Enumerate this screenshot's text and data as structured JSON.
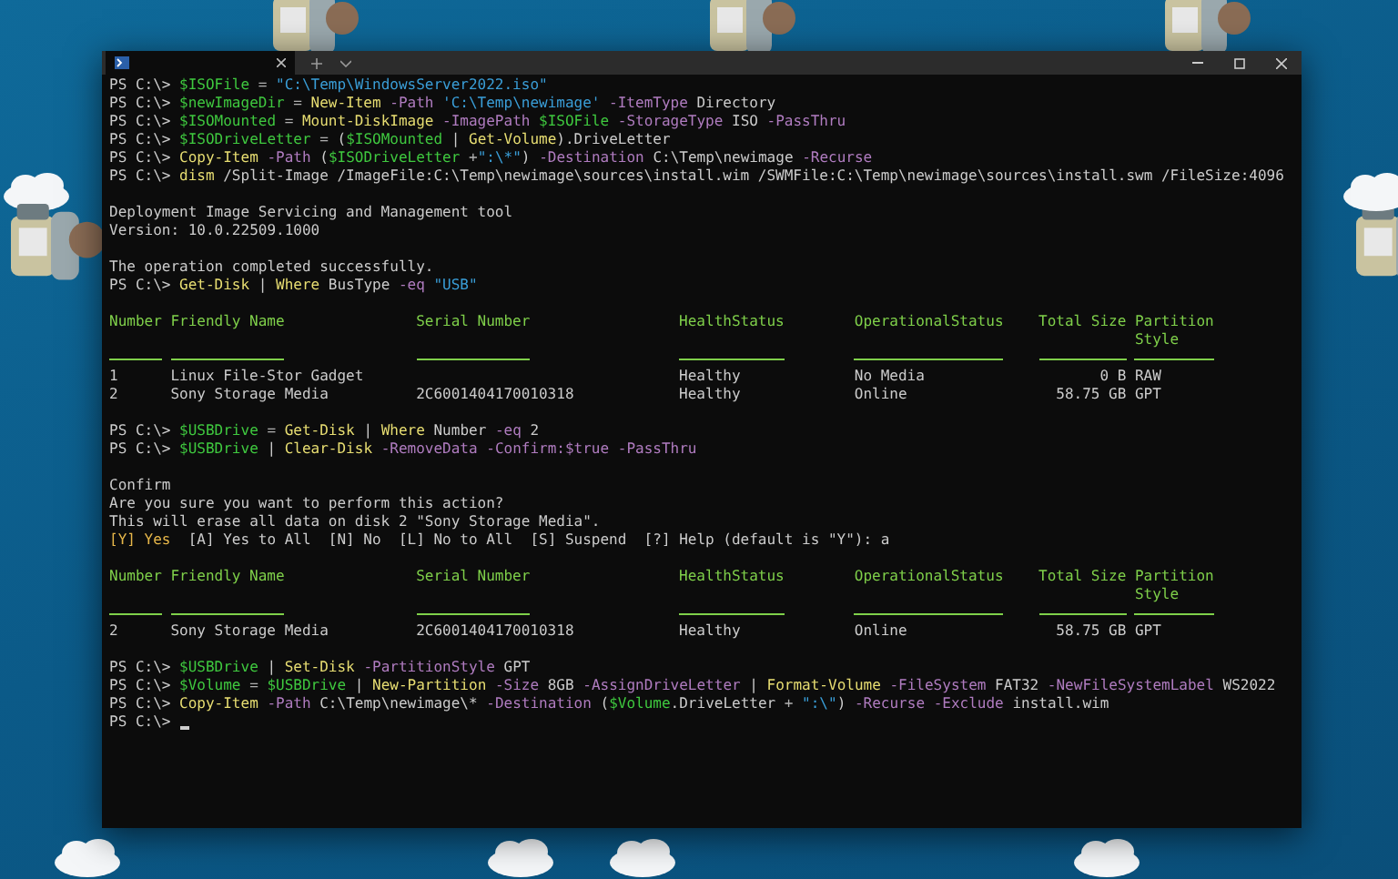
{
  "terminal": {
    "lines": [
      {
        "kind": "command",
        "tokens": [
          {
            "kind": "prompt",
            "text": "PS C:\\> "
          },
          {
            "kind": "variable",
            "text": "$ISOFile"
          },
          {
            "kind": "operator",
            "text": " = "
          },
          {
            "kind": "string",
            "text": "\"C:\\Temp\\WindowsServer2022.iso\""
          }
        ]
      },
      {
        "kind": "command",
        "tokens": [
          {
            "kind": "prompt",
            "text": "PS C:\\> "
          },
          {
            "kind": "variable",
            "text": "$newImageDir"
          },
          {
            "kind": "operator",
            "text": " = "
          },
          {
            "kind": "cmdlet",
            "text": "New-Item"
          },
          {
            "kind": "parameter",
            "text": " -Path"
          },
          {
            "kind": "string",
            "text": " 'C:\\Temp\\newimage'"
          },
          {
            "kind": "parameter",
            "text": " -ItemType"
          },
          {
            "kind": "plain",
            "text": " Directory"
          }
        ]
      },
      {
        "kind": "command",
        "tokens": [
          {
            "kind": "prompt",
            "text": "PS C:\\> "
          },
          {
            "kind": "variable",
            "text": "$ISOMounted"
          },
          {
            "kind": "operator",
            "text": " = "
          },
          {
            "kind": "cmdlet",
            "text": "Mount-DiskImage"
          },
          {
            "kind": "parameter",
            "text": " -ImagePath"
          },
          {
            "kind": "variable",
            "text": " $ISOFile"
          },
          {
            "kind": "parameter",
            "text": " -StorageType"
          },
          {
            "kind": "plain",
            "text": " ISO"
          },
          {
            "kind": "parameter",
            "text": " -PassThru"
          }
        ]
      },
      {
        "kind": "command",
        "tokens": [
          {
            "kind": "prompt",
            "text": "PS C:\\> "
          },
          {
            "kind": "variable",
            "text": "$ISODriveLetter"
          },
          {
            "kind": "operator",
            "text": " = "
          },
          {
            "kind": "plain",
            "text": "("
          },
          {
            "kind": "variable",
            "text": "$ISOMounted"
          },
          {
            "kind": "plain",
            "text": " | "
          },
          {
            "kind": "cmdlet",
            "text": "Get-Volume"
          },
          {
            "kind": "plain",
            "text": ").DriveLetter"
          }
        ]
      },
      {
        "kind": "command",
        "tokens": [
          {
            "kind": "prompt",
            "text": "PS C:\\> "
          },
          {
            "kind": "cmdlet",
            "text": "Copy-Item"
          },
          {
            "kind": "parameter",
            "text": " -Path"
          },
          {
            "kind": "plain",
            "text": " ("
          },
          {
            "kind": "variable",
            "text": "$ISODriveLetter"
          },
          {
            "kind": "operator",
            "text": " +"
          },
          {
            "kind": "string",
            "text": "\":\\*\""
          },
          {
            "kind": "plain",
            "text": ")"
          },
          {
            "kind": "parameter",
            "text": " -Destination"
          },
          {
            "kind": "plain",
            "text": " C:\\Temp\\newimage"
          },
          {
            "kind": "parameter",
            "text": " -Recurse"
          }
        ]
      },
      {
        "kind": "command",
        "tokens": [
          {
            "kind": "prompt",
            "text": "PS C:\\> "
          },
          {
            "kind": "cmdlet",
            "text": "dism"
          },
          {
            "kind": "plain",
            "text": " /Split-Image /ImageFile:C:\\Temp\\newimage\\sources\\install.wim /SWMFile:C:\\Temp\\newimage\\sources\\install.swm /FileSize:4096"
          }
        ]
      },
      {
        "kind": "blank"
      },
      {
        "kind": "output",
        "text": "Deployment Image Servicing and Management tool"
      },
      {
        "kind": "output",
        "text": "Version: 10.0.22509.1000"
      },
      {
        "kind": "blank"
      },
      {
        "kind": "output",
        "text": "The operation completed successfully."
      },
      {
        "kind": "command",
        "tokens": [
          {
            "kind": "prompt",
            "text": "PS C:\\> "
          },
          {
            "kind": "cmdlet",
            "text": "Get-Disk"
          },
          {
            "kind": "plain",
            "text": " | "
          },
          {
            "kind": "cmdlet",
            "text": "Where"
          },
          {
            "kind": "plain",
            "text": " BusType"
          },
          {
            "kind": "parameter",
            "text": " -eq"
          },
          {
            "kind": "string",
            "text": " \"USB\""
          }
        ]
      },
      {
        "kind": "blank"
      },
      {
        "kind": "table",
        "columns": [
          "Number",
          "Friendly Name",
          "Serial Number",
          "HealthStatus",
          "OperationalStatus",
          "Total Size",
          "Partition Style"
        ],
        "rows": [
          [
            "1",
            "Linux File-Stor Gadget",
            null,
            "Healthy",
            "No Media",
            "0 B",
            "RAW"
          ],
          [
            "2",
            "Sony Storage Media",
            "2C6001404170010318",
            "Healthy",
            "Online",
            "58.75 GB",
            "GPT"
          ]
        ]
      },
      {
        "kind": "blank"
      },
      {
        "kind": "command",
        "tokens": [
          {
            "kind": "prompt",
            "text": "PS C:\\> "
          },
          {
            "kind": "variable",
            "text": "$USBDrive"
          },
          {
            "kind": "operator",
            "text": " = "
          },
          {
            "kind": "cmdlet",
            "text": "Get-Disk"
          },
          {
            "kind": "plain",
            "text": " | "
          },
          {
            "kind": "cmdlet",
            "text": "Where"
          },
          {
            "kind": "plain",
            "text": " Number"
          },
          {
            "kind": "parameter",
            "text": " -eq"
          },
          {
            "kind": "plain",
            "text": " 2"
          }
        ]
      },
      {
        "kind": "command",
        "tokens": [
          {
            "kind": "prompt",
            "text": "PS C:\\> "
          },
          {
            "kind": "variable",
            "text": "$USBDrive"
          },
          {
            "kind": "plain",
            "text": " | "
          },
          {
            "kind": "cmdlet",
            "text": "Clear-Disk"
          },
          {
            "kind": "parameter",
            "text": " -RemoveData"
          },
          {
            "kind": "parameter",
            "text": " -Confirm:$true"
          },
          {
            "kind": "parameter",
            "text": " -PassThru"
          }
        ]
      },
      {
        "kind": "blank"
      },
      {
        "kind": "output",
        "text": "Confirm"
      },
      {
        "kind": "output",
        "text": "Are you sure you want to perform this action?"
      },
      {
        "kind": "output",
        "text": "This will erase all data on disk 2 \"Sony Storage Media\"."
      },
      {
        "kind": "prompt_choice",
        "tokens": [
          {
            "kind": "highlight",
            "text": "[Y] Yes"
          },
          {
            "kind": "plain",
            "text": "  [A] Yes to All  [N] No  [L] No to All  [S] Suspend  [?] Help (default is \"Y\"): a"
          }
        ]
      },
      {
        "kind": "blank"
      },
      {
        "kind": "table",
        "columns": [
          "Number",
          "Friendly Name",
          "Serial Number",
          "HealthStatus",
          "OperationalStatus",
          "Total Size",
          "Partition Style"
        ],
        "rows": [
          [
            "2",
            "Sony Storage Media",
            "2C6001404170010318",
            "Healthy",
            "Online",
            "58.75 GB",
            "GPT"
          ]
        ]
      },
      {
        "kind": "blank"
      },
      {
        "kind": "command",
        "tokens": [
          {
            "kind": "prompt",
            "text": "PS C:\\> "
          },
          {
            "kind": "variable",
            "text": "$USBDrive"
          },
          {
            "kind": "plain",
            "text": " | "
          },
          {
            "kind": "cmdlet",
            "text": "Set-Disk"
          },
          {
            "kind": "parameter",
            "text": " -PartitionStyle"
          },
          {
            "kind": "plain",
            "text": " GPT"
          }
        ]
      },
      {
        "kind": "command",
        "tokens": [
          {
            "kind": "prompt",
            "text": "PS C:\\> "
          },
          {
            "kind": "variable",
            "text": "$Volume"
          },
          {
            "kind": "operator",
            "text": " = "
          },
          {
            "kind": "variable",
            "text": "$USBDrive"
          },
          {
            "kind": "plain",
            "text": " | "
          },
          {
            "kind": "cmdlet",
            "text": "New-Partition"
          },
          {
            "kind": "parameter",
            "text": " -Size"
          },
          {
            "kind": "plain",
            "text": " 8GB"
          },
          {
            "kind": "parameter",
            "text": " -AssignDriveLetter"
          },
          {
            "kind": "plain",
            "text": " | "
          },
          {
            "kind": "cmdlet",
            "text": "Format-Volume"
          },
          {
            "kind": "parameter",
            "text": " -FileSystem"
          },
          {
            "kind": "plain",
            "text": " FAT32"
          },
          {
            "kind": "parameter",
            "text": " -NewFileSystemLabel"
          },
          {
            "kind": "plain",
            "text": " WS2022"
          }
        ]
      },
      {
        "kind": "command",
        "tokens": [
          {
            "kind": "prompt",
            "text": "PS C:\\> "
          },
          {
            "kind": "cmdlet",
            "text": "Copy-Item"
          },
          {
            "kind": "parameter",
            "text": " -Path"
          },
          {
            "kind": "plain",
            "text": " C:\\Temp\\newimage\\*"
          },
          {
            "kind": "parameter",
            "text": " -Destination"
          },
          {
            "kind": "plain",
            "text": " ("
          },
          {
            "kind": "variable",
            "text": "$Volume"
          },
          {
            "kind": "plain",
            "text": ".DriveLetter"
          },
          {
            "kind": "operator",
            "text": " +"
          },
          {
            "kind": "string",
            "text": " \":\\\""
          },
          {
            "kind": "plain",
            "text": ")"
          },
          {
            "kind": "parameter",
            "text": " -Recurse"
          },
          {
            "kind": "parameter",
            "text": " -Exclude"
          },
          {
            "kind": "plain",
            "text": " install.wim"
          }
        ]
      },
      {
        "kind": "command",
        "tokens": [
          {
            "kind": "prompt",
            "text": "PS C:\\> "
          }
        ],
        "cursor": true
      }
    ]
  }
}
